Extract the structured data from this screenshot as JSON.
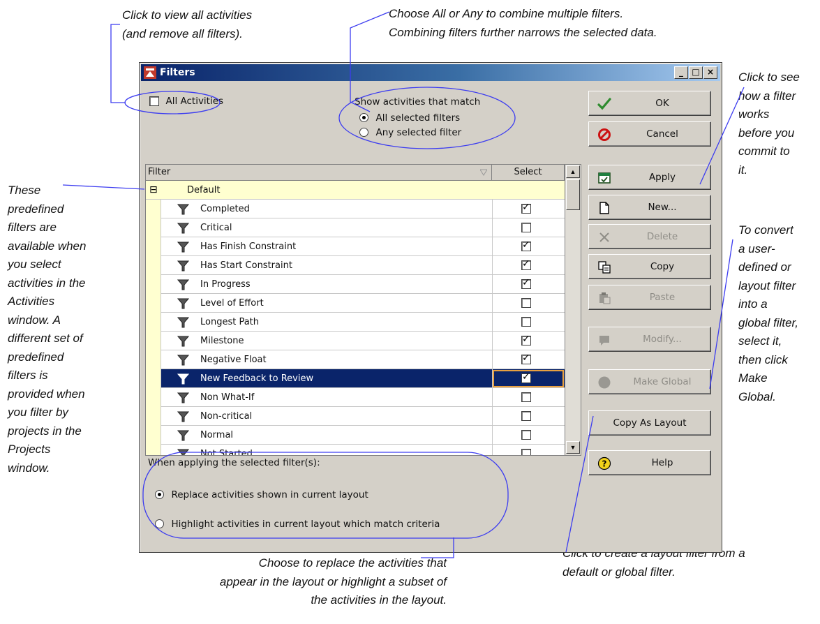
{
  "annotations": {
    "view_all": "Click to view all activities\n(and remove all filters).",
    "combine": "Choose All or Any to combine multiple filters.\nCombining filters further narrows the selected data.",
    "see_filter": "Click to see\nhow a filter\nworks\nbefore you\ncommit to\nit.",
    "predefined": "These\npredefined\nfilters are\navailable when\nyou select\nactivities in the\nActivities\nwindow. A\ndifferent set of\npredefined\nfilters is\nprovided when\nyou filter by\nprojects in the\nProjects\nwindow.",
    "convert": "To convert\na user-\ndefined or\nlayout filter\ninto a\nglobal filter,\nselect it,\nthen click\nMake\nGlobal.",
    "replace": "Choose to replace the activities that\nappear in the layout or highlight a subset of\nthe activities in the layout.",
    "layout_filter": "Click to create a layout filter from a\ndefault or global filter."
  },
  "window": {
    "title": "Filters",
    "minimize": "_",
    "maximize": "□",
    "close": "×"
  },
  "top": {
    "all_activities_label": "All Activities",
    "all_activities_checked": false,
    "match_title": "Show activities that match",
    "match_options": [
      "All selected filters",
      "Any selected filter"
    ],
    "match_selected": 0
  },
  "list": {
    "columns": [
      "Filter",
      "Select"
    ],
    "group": {
      "expander": "⊟",
      "label": "Default"
    },
    "rows": [
      {
        "name": "Completed",
        "checked": true
      },
      {
        "name": "Critical",
        "checked": false
      },
      {
        "name": "Has Finish Constraint",
        "checked": true
      },
      {
        "name": "Has Start Constraint",
        "checked": true
      },
      {
        "name": "In Progress",
        "checked": true
      },
      {
        "name": "Level of Effort",
        "checked": false
      },
      {
        "name": "Longest Path",
        "checked": false
      },
      {
        "name": "Milestone",
        "checked": true
      },
      {
        "name": "Negative Float",
        "checked": true
      },
      {
        "name": "New Feedback to Review",
        "checked": true,
        "selected": true
      },
      {
        "name": "Non What-If",
        "checked": false
      },
      {
        "name": "Non-critical",
        "checked": false
      },
      {
        "name": "Normal",
        "checked": false
      },
      {
        "name": "Not Started",
        "checked": false
      }
    ]
  },
  "apply": {
    "title": "When applying the selected filter(s):",
    "options": [
      "Replace activities shown in current layout",
      "Highlight activities in current layout which match criteria"
    ],
    "selected": 0
  },
  "buttons": {
    "ok": "OK",
    "cancel": "Cancel",
    "apply": "Apply",
    "new": "New...",
    "delete": "Delete",
    "copy": "Copy",
    "paste": "Paste",
    "modify": "Modify...",
    "make_global": "Make Global",
    "copy_as_layout": "Copy As Layout",
    "help": "Help"
  },
  "colors": {
    "title_bar": "#0a246a",
    "selection": "#0a246a",
    "group_row": "#ffffd0",
    "callout_outline": "#3c3cf0",
    "dialog_face": "#d4d0c8"
  }
}
